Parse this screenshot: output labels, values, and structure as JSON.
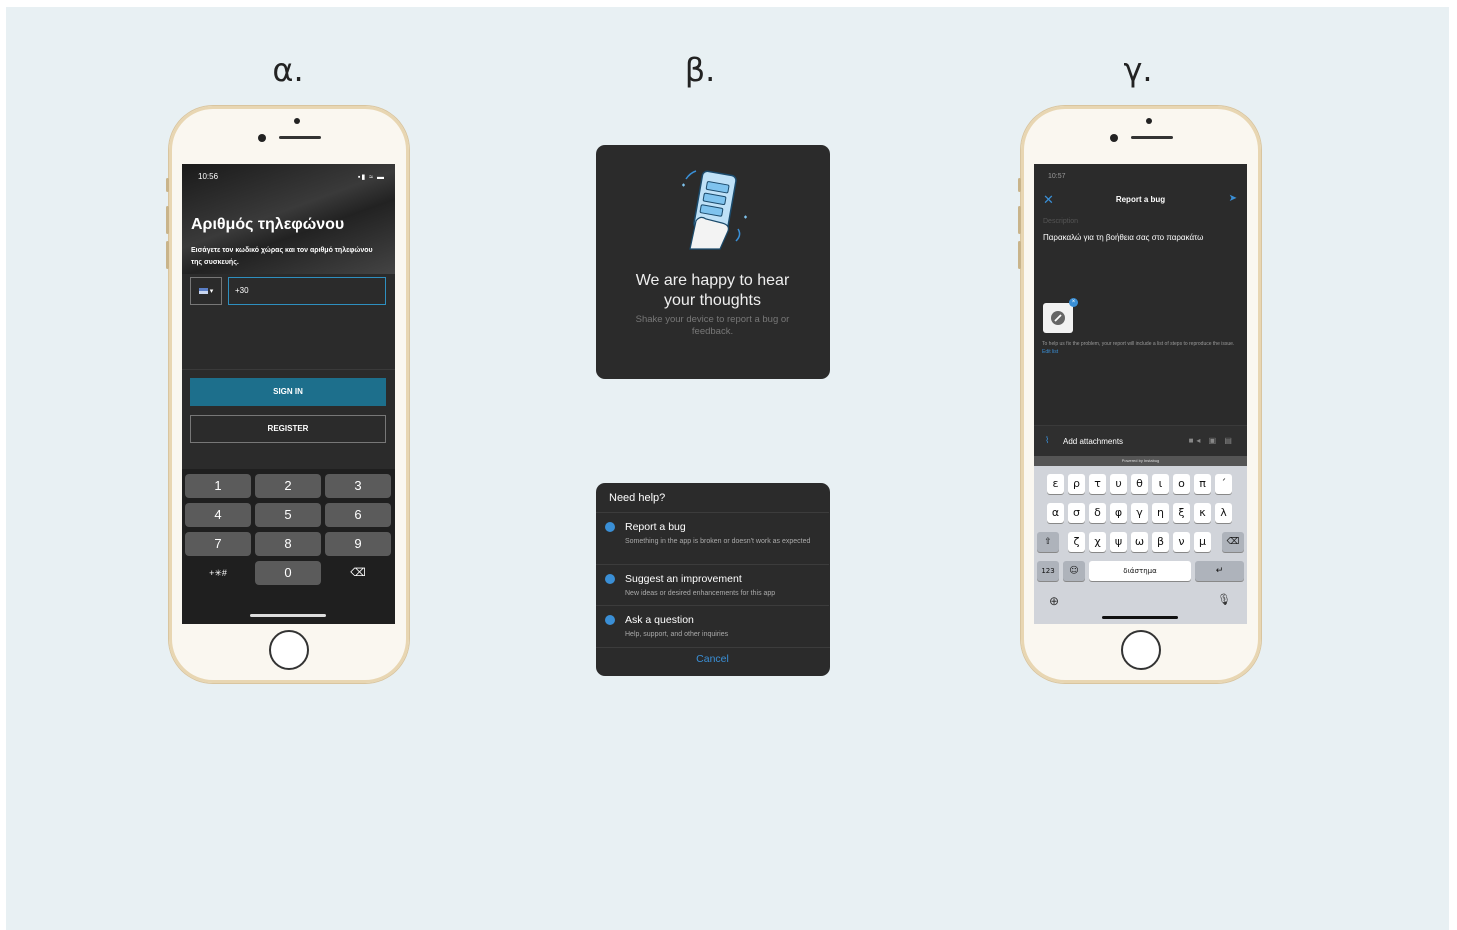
{
  "labels": {
    "a": "α.",
    "b": "β.",
    "c": "γ."
  },
  "phone_a": {
    "time": "10:56",
    "title": "Αριθμός τηλεφώνου",
    "description": "Εισάγετε τον κωδικό χώρας και τον αριθμό τηλεφώνου της συσκευής.",
    "country_code_icon": "flag-icon",
    "phone_value": "+30",
    "sign_in": "SIGN IN",
    "register": "REGISTER",
    "keys": [
      "1",
      "2",
      "3",
      "4",
      "5",
      "6",
      "7",
      "8",
      "9",
      "+✳#",
      "0",
      "⌫"
    ]
  },
  "panel_b": {
    "heading_line1": "We are happy to hear",
    "heading_line2": "your thoughts",
    "sub": "Shake your device to report a bug or feedback."
  },
  "menu": {
    "title": "Need help?",
    "items": [
      {
        "label": "Report a bug",
        "desc": "Something in the app is broken or doesn't work as expected",
        "icon": "bug-icon"
      },
      {
        "label": "Suggest an improvement",
        "desc": "New ideas or desired enhancements for this app",
        "icon": "megaphone-icon"
      },
      {
        "label": "Ask a question",
        "desc": "Help, support, and other inquiries",
        "icon": "question-icon"
      }
    ],
    "cancel": "Cancel"
  },
  "phone_c": {
    "time": "10:57",
    "nav_title": "Report a bug",
    "description_label": "Description",
    "description_text": "Παρακαλώ για τη βοήθεια σας στο παρακάτω",
    "hint": "To help us fix the problem, your report will include a list of steps to reproduce the issue.",
    "hint_link": "Edit list",
    "add_attachments": "Add attachments",
    "powered": "Powered by Instabug",
    "space": "διάστημα",
    "num_key": "123",
    "row1": [
      "ε",
      "ρ",
      "τ",
      "υ",
      "θ",
      "ι",
      "ο",
      "π",
      "΄"
    ],
    "row2": [
      "α",
      "σ",
      "δ",
      "φ",
      "γ",
      "η",
      "ξ",
      "κ",
      "λ"
    ],
    "row3": [
      "ζ",
      "χ",
      "ψ",
      "ω",
      "β",
      "ν",
      "μ"
    ]
  },
  "colors": {
    "accent": "#3a8fd6",
    "signin": "#1d6f8c",
    "canvas": "#e8f0f3"
  }
}
